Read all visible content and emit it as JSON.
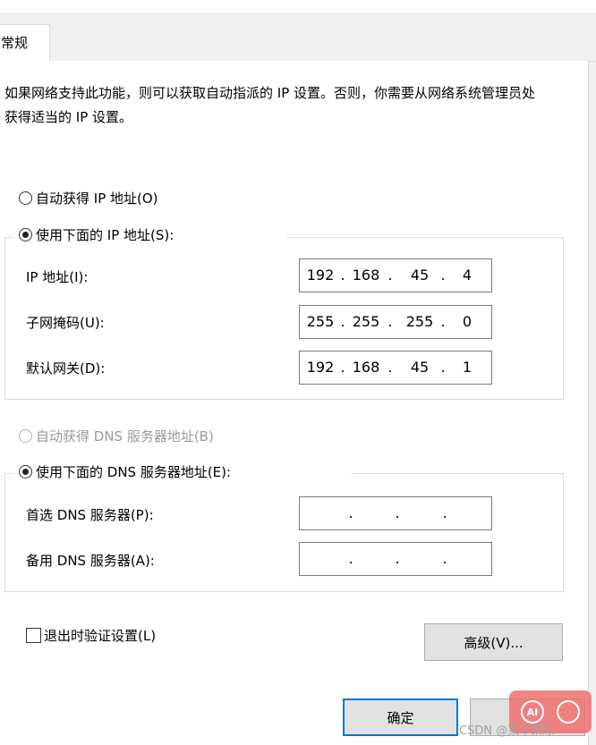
{
  "tab": {
    "label": "常规"
  },
  "description": "如果网络支持此功能，则可以获取自动指派的 IP 设置。否则，你需要从网络系统管理员处获得适当的 IP 设置。",
  "ip": {
    "auto_label": "自动获得 IP 地址(O)",
    "auto_selected": false,
    "manual_label": "使用下面的 IP 地址(S):",
    "manual_selected": true,
    "fields": {
      "address": {
        "label": "IP 地址(I):",
        "octets": [
          "192",
          "168",
          "45",
          "4"
        ]
      },
      "subnet": {
        "label": "子网掩码(U):",
        "octets": [
          "255",
          "255",
          "255",
          "0"
        ]
      },
      "gateway": {
        "label": "默认网关(D):",
        "octets": [
          "192",
          "168",
          "45",
          "1"
        ]
      }
    }
  },
  "dns": {
    "auto_label": "自动获得 DNS 服务器地址(B)",
    "auto_enabled": false,
    "manual_label": "使用下面的 DNS 服务器地址(E):",
    "manual_selected": true,
    "fields": {
      "preferred": {
        "label": "首选 DNS 服务器(P):",
        "octets": [
          "",
          "",
          "",
          ""
        ]
      },
      "alternate": {
        "label": "备用 DNS 服务器(A):",
        "octets": [
          "",
          "",
          "",
          ""
        ]
      }
    }
  },
  "validate_label": "退出时验证设置(L)",
  "validate_checked": false,
  "buttons": {
    "advanced": "高级(V)...",
    "ok": "确定"
  },
  "watermark": {
    "text": "CSDN @某个果冻",
    "icon_text": "AI"
  },
  "colors": {
    "accent": "#0078d7",
    "watermark": "#f06e6e"
  }
}
